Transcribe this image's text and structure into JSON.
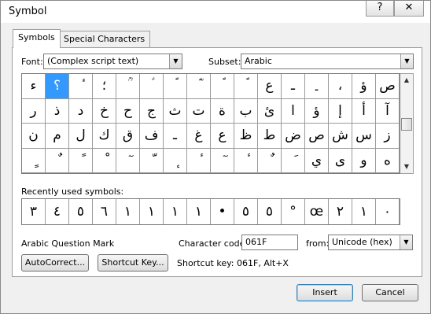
{
  "window": {
    "title": "Symbol",
    "help_glyph": "?",
    "close_glyph": "✕"
  },
  "tabs": [
    {
      "label": "Symbols"
    },
    {
      "label": "Special Characters"
    }
  ],
  "font": {
    "label": "Font:",
    "value": "(Complex script text)"
  },
  "subset": {
    "label": "Subset:",
    "value": "Arabic"
  },
  "symbol_grid": {
    "selected": "؟",
    "rows": [
      [
        "ء",
        "؟",
        "ٔ",
        "؛",
        "ؒ",
        "ؑ",
        "ؐ",
        "ؓ",
        "ؐ",
        "ؐ",
        "ع",
        "ـ",
        "۔",
        "،",
        "ؤ",
        "ص"
      ],
      [
        "ر",
        "ذ",
        "د",
        "خ",
        "ح",
        "ج",
        "ث",
        "ت",
        "ة",
        "ب",
        "ئ",
        "ا",
        "ؤ",
        "إ",
        "أ",
        "آ"
      ],
      [
        "ن",
        "م",
        "ل",
        "ك",
        "ق",
        "ف",
        "ـ",
        "غ",
        "ع",
        "ظ",
        "ط",
        "ض",
        "ص",
        "ش",
        "س",
        "ز"
      ],
      [
        "ٍ",
        "ٌ",
        "ً",
        "ْ",
        "ٓ",
        "ّ",
        "ٕ",
        "ٔ",
        "ٓ",
        "ٔ",
        "ٌ",
        "َ",
        "ي",
        "ى",
        "و",
        "ه"
      ]
    ]
  },
  "recent": {
    "label": "Recently used symbols:",
    "symbols": [
      "٣",
      "٤",
      "٥",
      "٦",
      "١",
      "١",
      "١",
      "١",
      "•",
      "٥",
      "٥",
      "°",
      "œ",
      "٢",
      "١",
      "٠"
    ]
  },
  "char_name": "Arabic Question Mark",
  "char_code": {
    "label": "Character code:",
    "value": "061F"
  },
  "from": {
    "label": "from:",
    "value": "Unicode (hex)"
  },
  "buttons": {
    "autocorrect": "AutoCorrect...",
    "shortcut_key": "Shortcut Key...",
    "insert": "Insert",
    "cancel": "Cancel"
  },
  "shortcut_text": "Shortcut key: 061F, Alt+X",
  "colors": {
    "selection": "#3399ff"
  }
}
